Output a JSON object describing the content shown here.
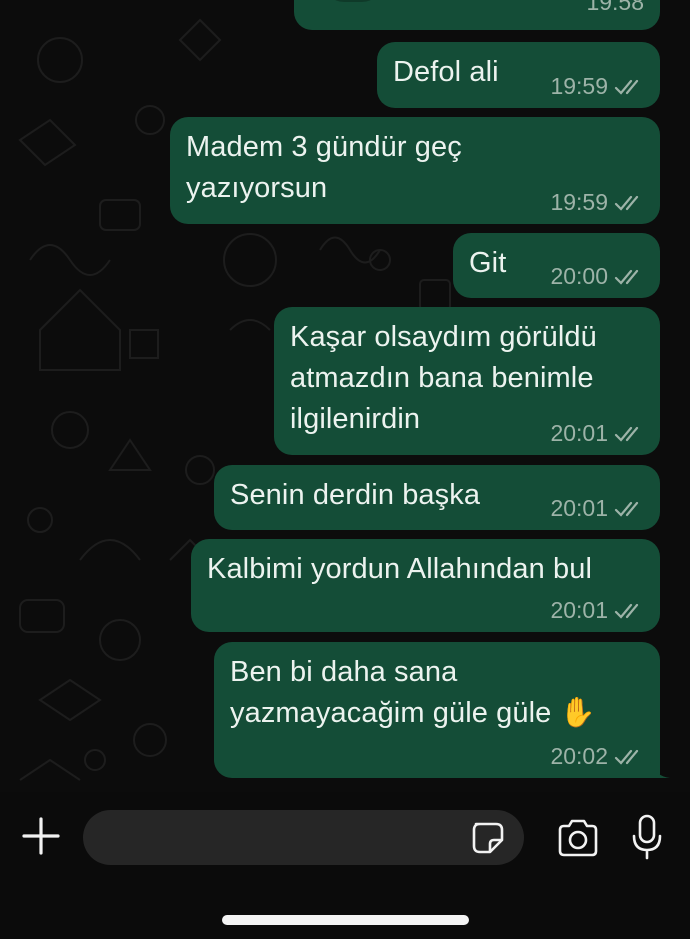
{
  "messages": [
    {
      "text": "",
      "time": "19:58",
      "partial": true
    },
    {
      "text": "Defol ali",
      "time": "19:59"
    },
    {
      "text": "Madem 3 gündür geç\nyazıyorsun",
      "time": "19:59"
    },
    {
      "text": "Git",
      "time": "20:00"
    },
    {
      "text": "Kaşar olsaydım görüldü\natmazdın bana benimle\nilgilenirdin",
      "time": "20:01"
    },
    {
      "text": "Senin derdin başka",
      "time": "20:01"
    },
    {
      "text": "Kalbimi yordun Allahından bul",
      "time": "20:01"
    },
    {
      "text": "Ben bi daha sana\nyazmayacağim güle güle ✋",
      "time": "20:02"
    }
  ],
  "input": {
    "placeholder": "",
    "value": ""
  },
  "icons": {
    "plus": "plus-icon",
    "sticker": "sticker-icon",
    "camera": "camera-icon",
    "mic": "microphone-icon",
    "read_receipt": "double-check-icon"
  },
  "colors": {
    "bubble": "#144d37",
    "text": "#ecf3ef",
    "meta": "#9db3a8",
    "background": "#0b0b0b",
    "input_field": "#262626"
  }
}
